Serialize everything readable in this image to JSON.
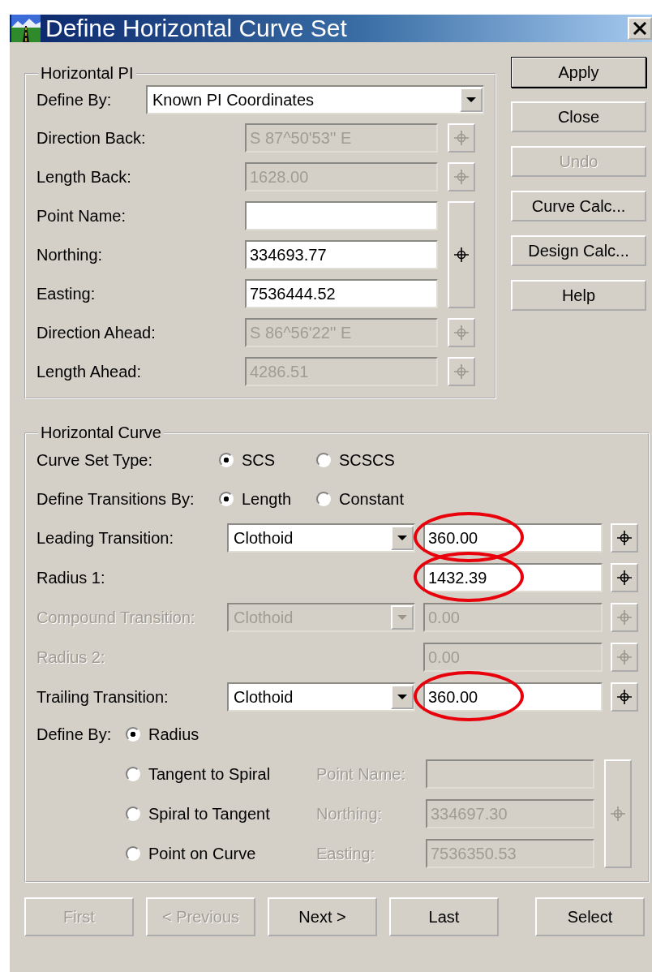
{
  "window": {
    "title": "Define Horizontal Curve Set"
  },
  "horizontal_pi": {
    "title": "Horizontal PI",
    "define_by": {
      "label": "Define By:",
      "value": "Known PI Coordinates"
    },
    "rows": [
      {
        "kind": "field",
        "label": "Direction Back:",
        "value": "S 87^50'53'' E",
        "disabled": true
      },
      {
        "kind": "field",
        "label": "Length Back:",
        "value": "1628.00",
        "disabled": true
      },
      {
        "kind": "group",
        "disabled": false,
        "fields": [
          {
            "label": "Point Name:"
          },
          {
            "label": "Northing:",
            "value": "334693.77"
          },
          {
            "label": "Easting:",
            "value": "7536444.52"
          }
        ]
      },
      {
        "kind": "field",
        "label": "Direction Ahead:",
        "value": "S 86^56'22'' E",
        "disabled": true
      },
      {
        "kind": "field",
        "label": "Length Ahead:",
        "value": "4286.51",
        "disabled": true
      }
    ]
  },
  "side_buttons": [
    {
      "label": "Apply",
      "disabled": false,
      "default": true
    },
    {
      "label": "Close",
      "disabled": false,
      "default": false
    },
    {
      "label": "Undo",
      "disabled": true,
      "default": false
    },
    {
      "label": "Curve Calc...",
      "disabled": false,
      "default": false
    },
    {
      "label": "Design Calc...",
      "disabled": false,
      "default": false
    },
    {
      "label": "Help",
      "disabled": false,
      "default": false
    }
  ],
  "horizontal_curve": {
    "title": "Horizontal Curve",
    "option_rows": [
      {
        "label": "Curve Set Type:",
        "options": [
          {
            "label": "SCS",
            "selected": true
          },
          {
            "label": "SCSCS",
            "selected": false
          }
        ]
      },
      {
        "label": "Define Transitions By:",
        "options": [
          {
            "label": "Length",
            "selected": true
          },
          {
            "label": "Constant",
            "selected": false
          }
        ]
      }
    ],
    "rows": [
      {
        "label": "Leading Transition:",
        "type": "Clothoid",
        "value": "360.00",
        "disabled": false,
        "highlighted": true
      },
      {
        "label": "Radius 1:",
        "value": "1432.39",
        "disabled": false,
        "highlighted": true
      },
      {
        "label": "Compound Transition:",
        "type": "Clothoid",
        "value": "0.00",
        "disabled": true
      },
      {
        "label": "Radius 2:",
        "value": "0.00",
        "disabled": true
      },
      {
        "label": "Trailing Transition:",
        "type": "Clothoid",
        "value": "360.00",
        "disabled": false,
        "highlighted": true
      }
    ],
    "define_by": {
      "label": "Define By:",
      "options": [
        {
          "label": "Radius",
          "selected": true
        },
        {
          "label": "Tangent to Spiral",
          "selected": false
        },
        {
          "label": "Spiral to Tangent",
          "selected": false
        },
        {
          "label": "Point on Curve",
          "selected": false
        }
      ]
    },
    "point": {
      "disabled": true,
      "fields": [
        {
          "label": "Point Name:"
        },
        {
          "label": "Northing:",
          "value": "334697.30"
        },
        {
          "label": "Easting:",
          "value": "7536350.53"
        }
      ]
    }
  },
  "bottom_buttons": [
    {
      "label": "First",
      "disabled": true
    },
    {
      "label": "< Previous",
      "disabled": true
    },
    {
      "label": "Next >",
      "disabled": false
    },
    {
      "label": "Last",
      "disabled": false
    },
    {
      "label": "Select",
      "disabled": false
    }
  ]
}
